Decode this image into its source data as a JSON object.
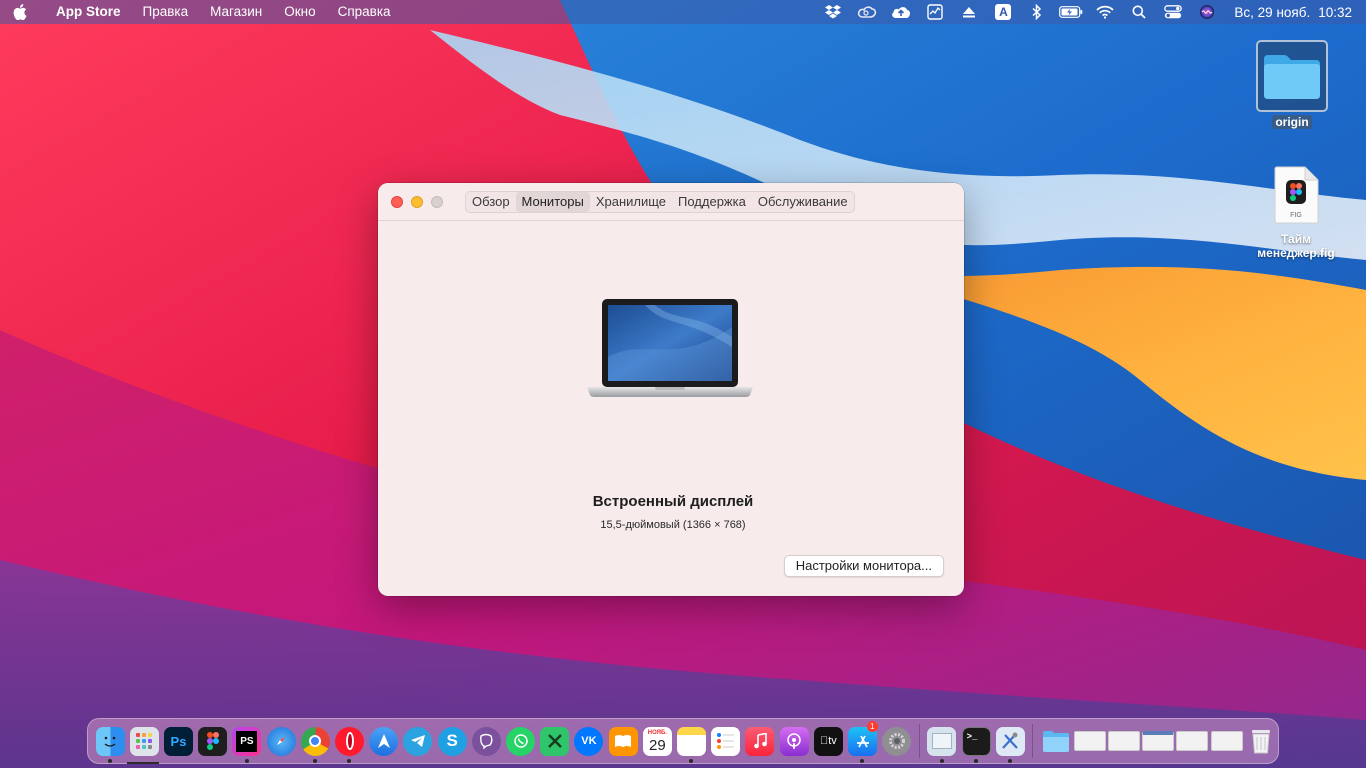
{
  "menubar": {
    "app_name": "App Store",
    "items": [
      "Правка",
      "Магазин",
      "Окно",
      "Справка"
    ],
    "status_icons": [
      "dropbox-icon",
      "creative-cloud-icon",
      "cloud-upload-icon",
      "activity-monitor-icon",
      "eject-icon",
      "input-source-icon",
      "bluetooth-icon",
      "battery-icon",
      "wifi-icon",
      "search-icon",
      "control-center-icon",
      "siri-icon"
    ],
    "input_source_letter": "A",
    "date": "Вс, 29 нояб.",
    "time": "10:32"
  },
  "desktop": {
    "icons": [
      {
        "label": "origin",
        "kind": "folder-icon"
      },
      {
        "label": "Тайм менеджер.fig",
        "kind": "figma-file-icon",
        "file_tag": "FIG"
      }
    ]
  },
  "window": {
    "tabs": [
      {
        "label": "Обзор",
        "active": false
      },
      {
        "label": "Мониторы",
        "active": true
      },
      {
        "label": "Хранилище",
        "active": false
      },
      {
        "label": "Поддержка",
        "active": false
      },
      {
        "label": "Обслуживание",
        "active": false
      }
    ],
    "display_name": "Встроенный дисплей",
    "display_spec": "15,5-дюймовый (1366 × 768)",
    "settings_button": "Настройки монитора..."
  },
  "dock": {
    "calendar_month": "НОЯБ.",
    "calendar_day": "29",
    "app_store_badge": "1",
    "apple_tv_label": "tv",
    "apps": [
      "finder",
      "launchpad",
      "photoshop",
      "figma",
      "phpstorm",
      "safari",
      "chrome",
      "opera",
      "spark",
      "telegram",
      "skype",
      "viber",
      "whatsapp",
      "xmind",
      "vk",
      "books",
      "calendar",
      "notes",
      "reminders",
      "music",
      "podcasts",
      "apple-tv",
      "app-store",
      "system-preferences",
      "preview",
      "terminal",
      "xcode-tools",
      "downloads-folder",
      "window-1",
      "window-2",
      "window-3",
      "window-4",
      "window-5",
      "trash"
    ]
  },
  "colors": {
    "window_bg": "#f7ebeb",
    "close": "#ff5f57",
    "minimize": "#febc2e"
  }
}
